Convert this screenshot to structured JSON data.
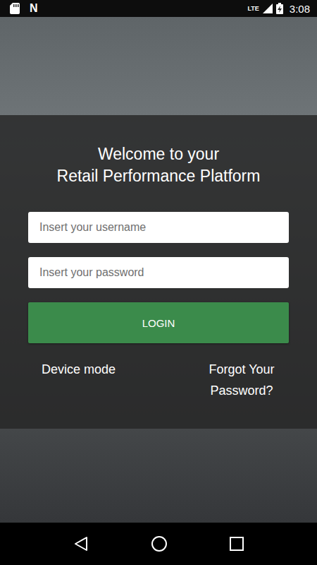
{
  "status_bar": {
    "notification_badge": "N",
    "network": "LTE",
    "time": "3:08"
  },
  "title_lines": [
    "Welcome to your",
    "Retail Performance Platform"
  ],
  "fields": [
    {
      "placeholder": "Insert your username",
      "kind": "text"
    },
    {
      "placeholder": "Insert your password",
      "kind": "password"
    }
  ],
  "login_button": "LOGIN",
  "links": [
    {
      "label": "Device mode"
    },
    {
      "label": "Forgot Your Password?"
    }
  ]
}
